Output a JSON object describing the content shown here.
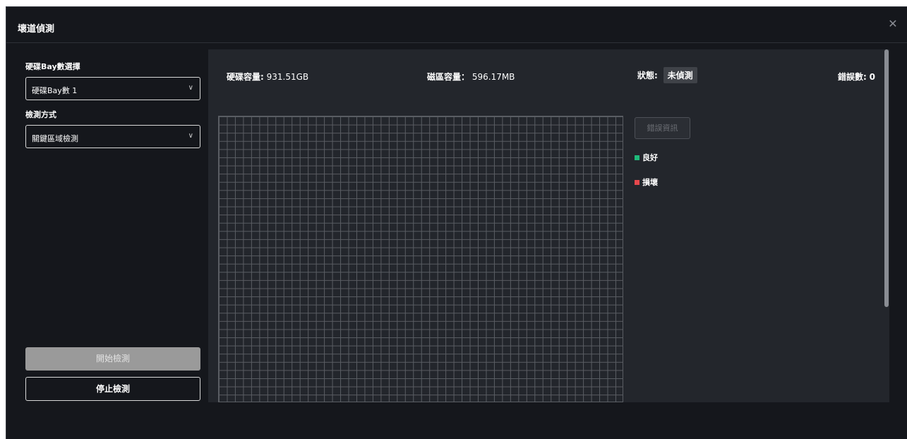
{
  "dialog": {
    "title": "壞道偵測",
    "close_glyph": "✕"
  },
  "left": {
    "bay_label": "硬碟Bay數選擇",
    "bay_value": "硬碟Bay數 1",
    "method_label": "檢測方式",
    "method_value": "關鍵區域檢測",
    "chevron_glyph": "∨",
    "start_button": "開始檢測",
    "stop_button": "停止檢測"
  },
  "info": {
    "disk_capacity_label": "硬碟容量:",
    "disk_capacity_value": "931.51GB",
    "sector_capacity_label": "磁區容量：",
    "sector_capacity_value": "596.17MB",
    "status_label": "狀態:",
    "status_value": "未偵測",
    "error_count_label": "錯誤數:",
    "error_count_value": "0"
  },
  "side": {
    "error_info_button": "錯誤資訊",
    "legend_good": "良好",
    "legend_bad": "損壞"
  },
  "colors": {
    "good": "#1fb97a",
    "bad": "#e5484d"
  }
}
